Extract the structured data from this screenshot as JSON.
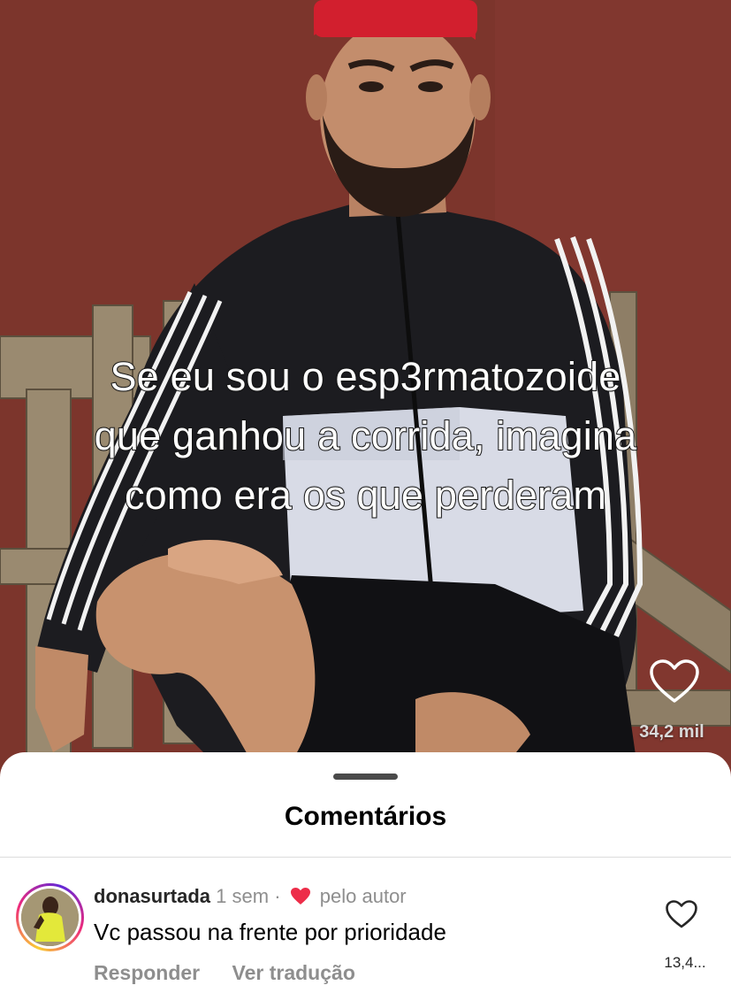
{
  "video": {
    "caption_lines": [
      "Se eu sou o esp3rmatozoide",
      "que ganhou a corrida, imagina",
      "como era os que perderam"
    ],
    "like_icon": "heart-outline-icon",
    "like_count": "34,2 mil"
  },
  "comments_sheet": {
    "title": "Comentários",
    "comment": {
      "username": "donasurtada",
      "time": "1 sem",
      "separator": "·",
      "liked_by_author_icon": "heart-filled-icon",
      "liked_by_author_label": "pelo autor",
      "text": "Vc passou na frente por prioridade",
      "reply_label": "Responder",
      "translate_label": "Ver tradução",
      "like_icon": "heart-outline-icon",
      "like_count": "13,4..."
    }
  },
  "colors": {
    "wall": "#7d342b",
    "author_heart": "#ed2d49",
    "muted_text": "#8e8e8e"
  }
}
